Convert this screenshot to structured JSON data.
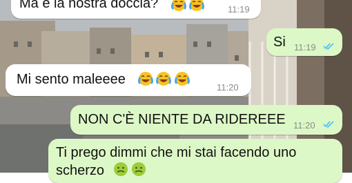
{
  "chat": {
    "messages": [
      {
        "direction": "incoming",
        "text": "Ma è la nostra doccia?",
        "emoji": [
          "face-with-tears-of-joy-icon",
          "face-with-tears-of-joy-icon"
        ],
        "time": "11:19"
      },
      {
        "direction": "outgoing",
        "text": "Si",
        "time": "11:19",
        "status": "read"
      },
      {
        "direction": "incoming",
        "text": "Mi sento maleeee",
        "emoji": [
          "face-with-tears-of-joy-icon",
          "face-with-tears-of-joy-icon",
          "face-with-tears-of-joy-icon"
        ],
        "time": "11:20"
      },
      {
        "direction": "outgoing",
        "text": "NON C'È NIENTE DA RIDEREEE",
        "time": "11:20",
        "status": "read"
      },
      {
        "direction": "outgoing",
        "text": "Ti prego dimmi che mi stai facendo uno",
        "text_line2": "scherzo",
        "emoji": [
          "nauseated-face-icon",
          "nauseated-face-icon"
        ]
      }
    ]
  },
  "colors": {
    "incoming_bubble": "#ffffff",
    "outgoing_bubble": "#dcf8c6",
    "read_ticks": "#4fc3f7",
    "timestamp": "#8a8a8a"
  }
}
